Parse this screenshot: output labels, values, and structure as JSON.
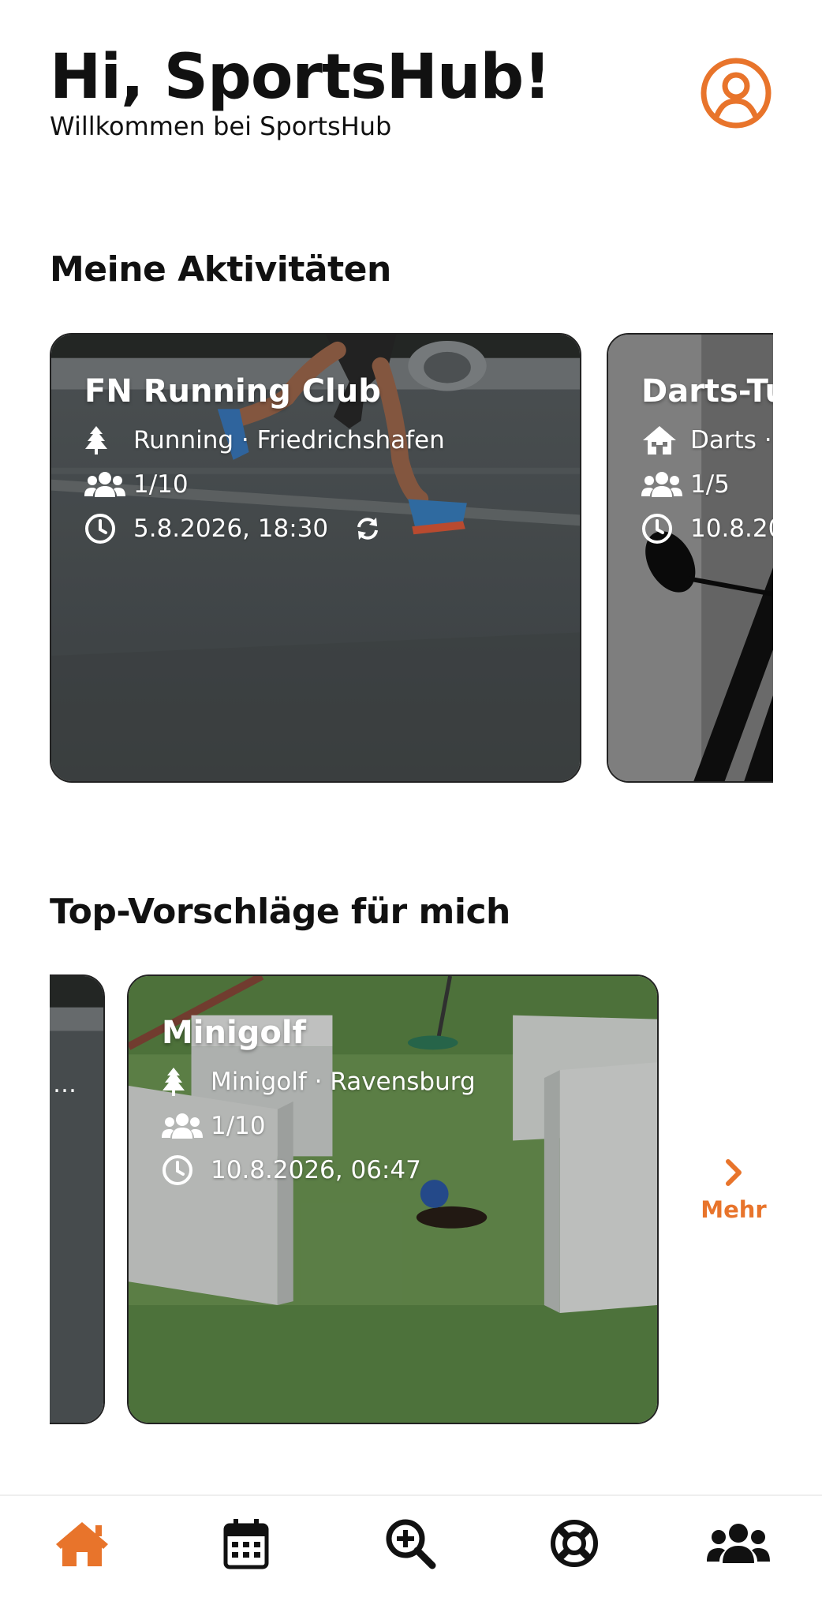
{
  "header": {
    "greeting": "Hi, SportsHub!",
    "subtitle": "Willkommen bei SportsHub",
    "profile_icon": "user-circle-icon"
  },
  "colors": {
    "accent": "#e8742b",
    "text": "#111111",
    "background": "#ffffff"
  },
  "my_activities": {
    "title": "Meine Aktivitäten",
    "cards": [
      {
        "title": "FN Running Club",
        "category_icon": "tree-icon",
        "category": "Running · Friedrichshafen",
        "participants": "1/10",
        "datetime": "5.8.2026, 18:30",
        "recurring_icon": "sync-icon"
      },
      {
        "title": "Darts-Tu",
        "category_icon": "house-icon",
        "category": "Darts ·",
        "participants": "1/5",
        "datetime": "10.8.20"
      }
    ]
  },
  "suggestions": {
    "title": "Top-Vorschläge für mich",
    "partial_card_text": "…",
    "cards": [
      {
        "title": "Minigolf",
        "category_icon": "tree-icon",
        "category": "Minigolf · Ravensburg",
        "participants": "1/10",
        "datetime": "10.8.2026, 06:47"
      }
    ],
    "more_label": "Mehr"
  },
  "bottom_nav": {
    "items": [
      {
        "icon": "home-icon",
        "active": true
      },
      {
        "icon": "calendar-icon",
        "active": false
      },
      {
        "icon": "search-plus-icon",
        "active": false
      },
      {
        "icon": "lifebuoy-icon",
        "active": false
      },
      {
        "icon": "users-icon",
        "active": false
      }
    ]
  }
}
